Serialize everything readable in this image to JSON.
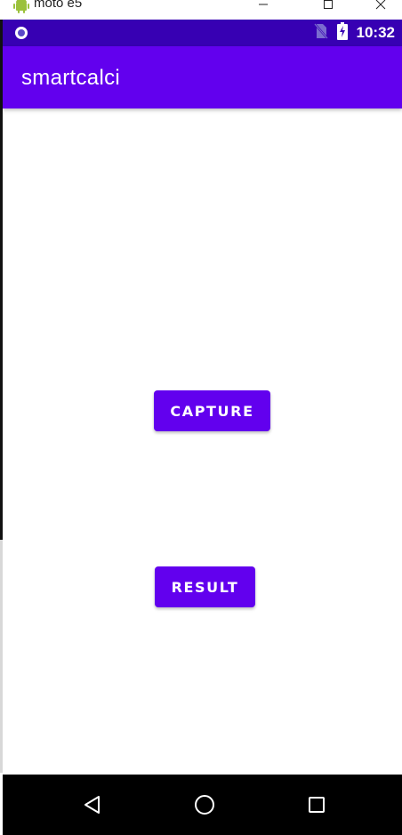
{
  "window": {
    "title": "moto e5",
    "controls": [
      "minimize-icon",
      "maximize-icon",
      "close-icon"
    ]
  },
  "status_bar": {
    "left_icon": "notification-dot-icon",
    "icons": [
      "no-sim-icon",
      "battery-charging-icon"
    ],
    "time": "10:32"
  },
  "app_bar": {
    "title": "smartcalci"
  },
  "main": {
    "capture_label": "CAPTURE",
    "result_label": "RESULT"
  },
  "nav_bar": {
    "buttons": [
      "back-icon",
      "home-icon",
      "recents-icon"
    ]
  },
  "colors": {
    "primary": "#6200ee",
    "primary_dark": "#3700b3",
    "nav_bar": "#000000",
    "background": "#ffffff"
  }
}
